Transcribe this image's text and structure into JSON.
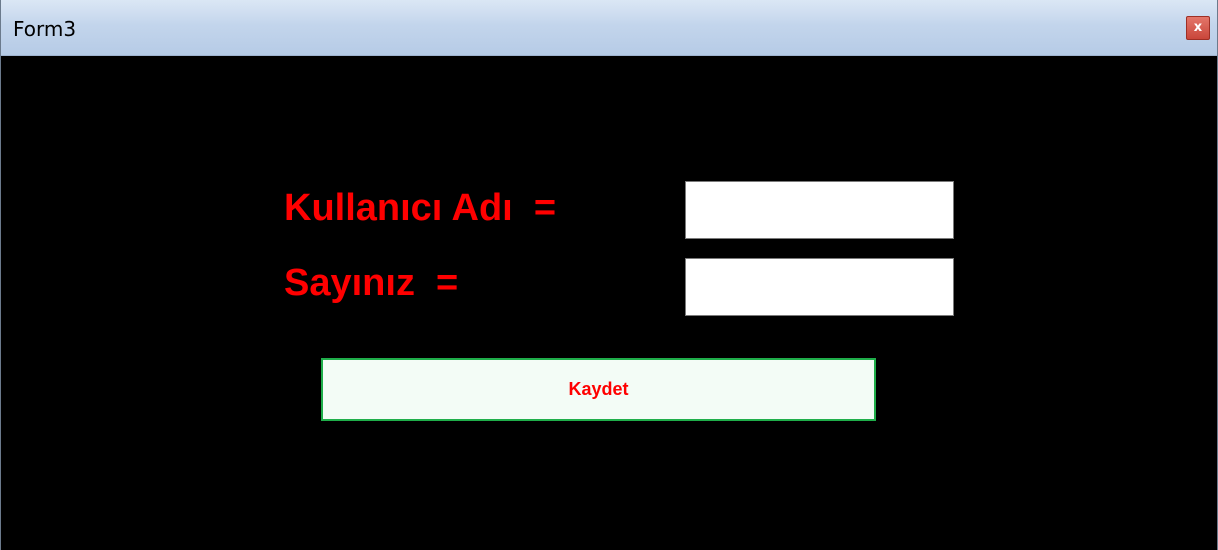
{
  "window": {
    "title": "Form3",
    "close_glyph": "x",
    "close_icon": "close-icon",
    "colors": {
      "client_background": "#000000",
      "label_text": "#ff0000",
      "button_border": "#1fae4a",
      "button_background": "#f3fcf6",
      "close_button": "#c9463a"
    }
  },
  "form": {
    "username_label": "Kullanıcı Adı  =",
    "username_value": "",
    "sayiniz_label": "Sayınız  =",
    "sayiniz_value": "",
    "save_label": "Kaydet"
  }
}
